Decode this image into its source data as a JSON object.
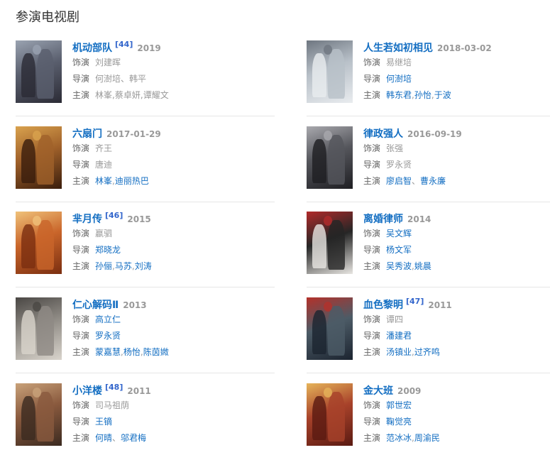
{
  "section_title": "参演电视剧",
  "left": [
    {
      "title": "机动部队",
      "sup": "[44]",
      "year": "2019",
      "role_label": "饰演",
      "role": "刘建晖",
      "role_link": false,
      "director_label": "导演",
      "directors": [
        {
          "name": "何澍培",
          "link": false
        },
        {
          "name": "韩平",
          "link": false
        }
      ],
      "director_sep": "、",
      "cast_label": "主演",
      "cast": [
        {
          "name": "林峯",
          "link": false
        },
        {
          "name": "蔡卓妍",
          "link": false
        },
        {
          "name": "谭耀文",
          "link": false
        }
      ],
      "cast_sep": ",",
      "poster_title": "机动部队",
      "colors": [
        "#2b2b35",
        "#5a5f6e",
        "#9aa3b1"
      ]
    },
    {
      "title": "六扇门",
      "sup": "",
      "year": "2017-01-29",
      "role_label": "饰演",
      "role": "齐王",
      "role_link": false,
      "director_label": "导演",
      "directors": [
        {
          "name": "唐迪",
          "link": false
        }
      ],
      "director_sep": "、",
      "cast_label": "主演",
      "cast": [
        {
          "name": "林峯",
          "link": true
        },
        {
          "name": "迪丽热巴",
          "link": true
        }
      ],
      "cast_sep": ",",
      "poster_title": "六扇门",
      "colors": [
        "#3a1d0c",
        "#a0612a",
        "#d9a24e"
      ]
    },
    {
      "title": "芈月传",
      "sup": "[46]",
      "year": "2015",
      "role_label": "饰演",
      "role": "嬴驷",
      "role_link": false,
      "director_label": "导演",
      "directors": [
        {
          "name": "郑晓龙",
          "link": true
        }
      ],
      "director_sep": "、",
      "cast_label": "主演",
      "cast": [
        {
          "name": "孙俪",
          "link": true
        },
        {
          "name": "马苏",
          "link": true
        },
        {
          "name": "刘涛",
          "link": true
        }
      ],
      "cast_sep": ",",
      "poster_title": "芈月传",
      "colors": [
        "#7a2e10",
        "#c9652a",
        "#f0c27a"
      ]
    },
    {
      "title": "仁心解码Ⅱ",
      "sup": "",
      "year": "2013",
      "role_label": "饰演",
      "role": "高立仁",
      "role_link": true,
      "director_label": "导演",
      "directors": [
        {
          "name": "罗永贤",
          "link": true
        }
      ],
      "director_sep": "、",
      "cast_label": "主演",
      "cast": [
        {
          "name": "蒙嘉慧",
          "link": true
        },
        {
          "name": "杨怡",
          "link": true
        },
        {
          "name": "陈茵媺",
          "link": true
        }
      ],
      "cast_sep": ",",
      "poster_title": "仁心解码",
      "colors": [
        "#d9d4cc",
        "#8e8a84",
        "#4a4744"
      ]
    },
    {
      "title": "小洋楼",
      "sup": "[48]",
      "year": "2011",
      "role_label": "饰演",
      "role": "司马祖荫",
      "role_link": false,
      "director_label": "导演",
      "directors": [
        {
          "name": "王镝",
          "link": true
        }
      ],
      "director_sep": "、",
      "cast_label": "主演",
      "cast": [
        {
          "name": "何晴",
          "link": true
        },
        {
          "name": "邬君梅",
          "link": true
        }
      ],
      "cast_sep": "、",
      "poster_title": "小洋楼",
      "colors": [
        "#3b2a20",
        "#8a5a3e",
        "#c9a27a"
      ]
    }
  ],
  "right": [
    {
      "title": "人生若如初相见",
      "sup": "",
      "year": "2018-03-02",
      "role_label": "饰演",
      "role": "易继培",
      "role_link": false,
      "director_label": "导演",
      "directors": [
        {
          "name": "何澍培",
          "link": true
        }
      ],
      "director_sep": "、",
      "cast_label": "主演",
      "cast": [
        {
          "name": "韩东君",
          "link": true
        },
        {
          "name": "孙怡",
          "link": true
        },
        {
          "name": "于波",
          "link": true
        }
      ],
      "cast_sep": ",",
      "poster_title": "人生若如初相见",
      "colors": [
        "#e9ecef",
        "#b8c0c8",
        "#6e7680"
      ]
    },
    {
      "title": "律政强人",
      "sup": "",
      "year": "2016-09-19",
      "role_label": "饰演",
      "role": "张强",
      "role_link": false,
      "director_label": "导演",
      "directors": [
        {
          "name": "罗永贤",
          "link": false
        }
      ],
      "director_sep": "、",
      "cast_label": "主演",
      "cast": [
        {
          "name": "廖启智",
          "link": true
        },
        {
          "name": "曹永廉",
          "link": true
        }
      ],
      "cast_sep": "、",
      "poster_title": "律政强人",
      "colors": [
        "#1e1e22",
        "#55565c",
        "#a9a9ae"
      ]
    },
    {
      "title": "离婚律师",
      "sup": "",
      "year": "2014",
      "role_label": "饰演",
      "role": "吴文辉",
      "role_link": true,
      "director_label": "导演",
      "directors": [
        {
          "name": "杨文军",
          "link": true
        }
      ],
      "director_sep": "、",
      "cast_label": "主演",
      "cast": [
        {
          "name": "吴秀波",
          "link": true
        },
        {
          "name": "姚晨",
          "link": true
        }
      ],
      "cast_sep": ",",
      "poster_title": "离婚律师",
      "colors": [
        "#e8e6e2",
        "#262626",
        "#b12a2a"
      ]
    },
    {
      "title": "血色黎明",
      "sup": "[47]",
      "year": "2011",
      "role_label": "饰演",
      "role": "谭四",
      "role_link": false,
      "director_label": "导演",
      "directors": [
        {
          "name": "潘建君",
          "link": true
        }
      ],
      "director_sep": "、",
      "cast_label": "主演",
      "cast": [
        {
          "name": "汤镇业",
          "link": true
        },
        {
          "name": "过齐鸣",
          "link": true
        }
      ],
      "cast_sep": ",",
      "poster_title": "血色黎明",
      "colors": [
        "#1c2430",
        "#4c5b66",
        "#b4312a"
      ]
    },
    {
      "title": "金大班",
      "sup": "",
      "year": "2009",
      "role_label": "饰演",
      "role": "郭世宏",
      "role_link": true,
      "director_label": "导演",
      "directors": [
        {
          "name": "鞠觉亮",
          "link": true
        }
      ],
      "director_sep": "、",
      "cast_label": "主演",
      "cast": [
        {
          "name": "范冰冰",
          "link": true
        },
        {
          "name": "周渝民",
          "link": true
        }
      ],
      "cast_sep": ",",
      "poster_title": "金大班",
      "colors": [
        "#5a1a12",
        "#a8422a",
        "#e6b45a"
      ]
    }
  ]
}
